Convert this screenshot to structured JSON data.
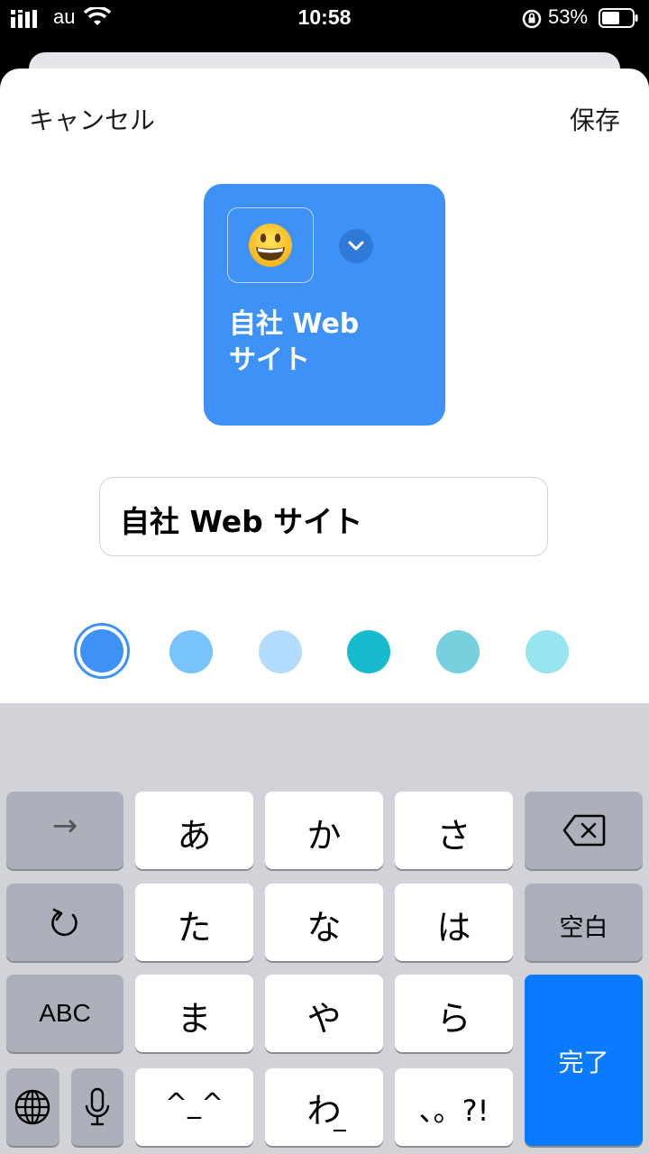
{
  "status": {
    "carrier": "au",
    "time": "10:58",
    "battery": "53%"
  },
  "header": {
    "cancel": "キャンセル",
    "save": "保存"
  },
  "preview": {
    "icon": "grinning-face-emoji",
    "title_line1": "自社 Web",
    "title_line2": "サイト",
    "color": "#3d91f7"
  },
  "name_field": {
    "value": "自社 Web サイト"
  },
  "colors": [
    "#3d91f7",
    "#78c3fb",
    "#b3dcfd",
    "#16bccd",
    "#76d0dd",
    "#97e5ee"
  ],
  "selected_color": 0,
  "keyboard": {
    "arrow": "→",
    "a": "あ",
    "ka": "か",
    "sa": "さ",
    "undo": "undo-icon",
    "ta": "た",
    "na": "な",
    "ha": "は",
    "space": "空白",
    "abc": "ABC",
    "ma": "ま",
    "ya": "や",
    "ra": "ら",
    "done": "完了",
    "emoticon": "^_^",
    "wa": "わ",
    "punct": "、。?!"
  }
}
